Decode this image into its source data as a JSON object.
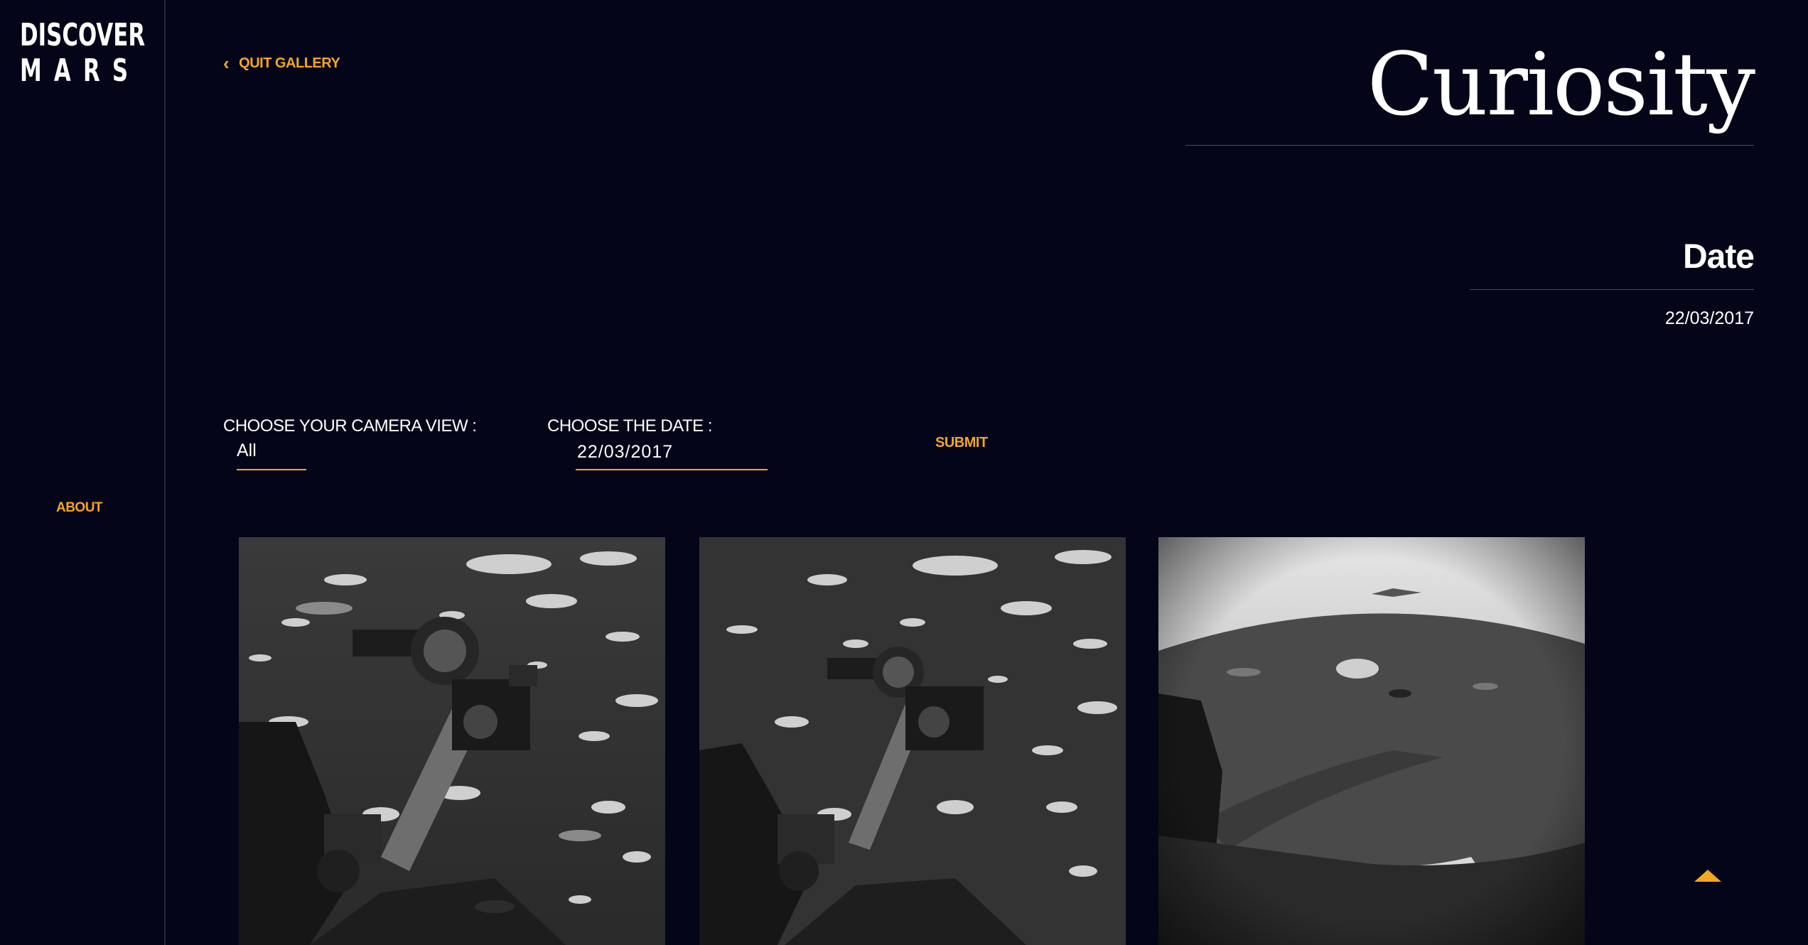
{
  "brand": {
    "line1": "DISCOVER",
    "line2": "MARS"
  },
  "sidebar": {
    "about_label": "ABOUT"
  },
  "nav": {
    "quit_label": "QUIT GALLERY"
  },
  "header": {
    "title": "Curiosity",
    "date_heading": "Date",
    "date_value": "22/03/2017"
  },
  "filters": {
    "camera_label": "CHOOSE YOUR CAMERA VIEW :",
    "camera_value": "All",
    "date_label": "CHOOSE THE DATE :",
    "date_value": "22/03/2017",
    "submit_label": "SUBMIT"
  },
  "gallery": {
    "photos": [
      {
        "subject": "rover-arm-on-rocky-terrain"
      },
      {
        "subject": "rover-arm-on-rocky-terrain"
      },
      {
        "subject": "fisheye-horizon-with-wheel"
      }
    ]
  },
  "colors": {
    "background": "#040518",
    "accent": "#f5a623",
    "text": "#ffffff",
    "rule": "#4a4b5a"
  }
}
